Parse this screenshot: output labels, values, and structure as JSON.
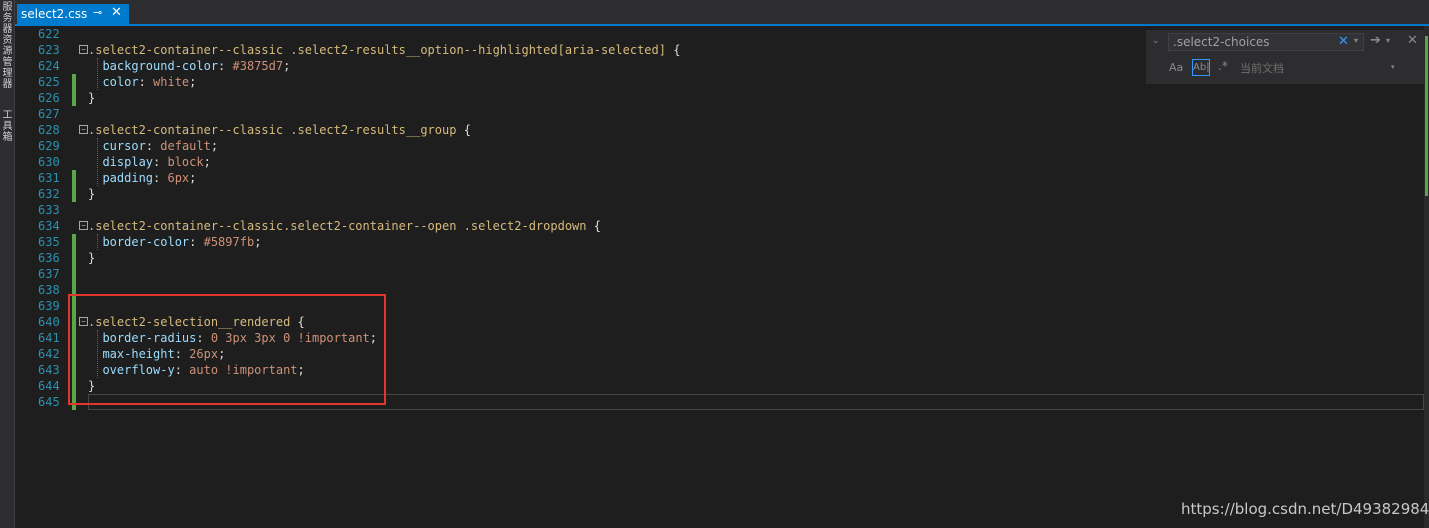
{
  "left_strip": {
    "tab1": "服务器资源管理器",
    "tab2": "工具箱"
  },
  "tab": {
    "title": "select2.css",
    "pin_icon": "pin-icon",
    "close_icon": "close-icon"
  },
  "find": {
    "value": ".select2-choices",
    "scope": "当前文档",
    "match_case": "Aa",
    "whole_word": "Ab|",
    "regex": ".*"
  },
  "colors": {
    "accent": "#007acc",
    "selector": "#d7ba7d",
    "property": "#9cdcfe",
    "value": "#ce9178",
    "line_number": "#2b91af",
    "highlight_box": "#e0362c",
    "change_bar": "#57a64a"
  },
  "lines": [
    {
      "n": "622",
      "code": ""
    },
    {
      "n": "623",
      "code": ".select2-container--classic .select2-results__option--highlighted[aria-selected] {"
    },
    {
      "n": "624",
      "code": "  background-color: #3875d7;"
    },
    {
      "n": "625",
      "code": "  color: white;"
    },
    {
      "n": "626",
      "code": "}"
    },
    {
      "n": "627",
      "code": ""
    },
    {
      "n": "628",
      "code": ".select2-container--classic .select2-results__group {"
    },
    {
      "n": "629",
      "code": "  cursor: default;"
    },
    {
      "n": "630",
      "code": "  display: block;"
    },
    {
      "n": "631",
      "code": "  padding: 6px;"
    },
    {
      "n": "632",
      "code": "}"
    },
    {
      "n": "633",
      "code": ""
    },
    {
      "n": "634",
      "code": ".select2-container--classic.select2-container--open .select2-dropdown {"
    },
    {
      "n": "635",
      "code": "  border-color: #5897fb;"
    },
    {
      "n": "636",
      "code": "}"
    },
    {
      "n": "637",
      "code": ""
    },
    {
      "n": "638",
      "code": ""
    },
    {
      "n": "639",
      "code": ""
    },
    {
      "n": "640",
      "code": ".select2-selection__rendered {"
    },
    {
      "n": "641",
      "code": "  border-radius: 0 3px 3px 0 !important;"
    },
    {
      "n": "642",
      "code": "  max-height: 26px;"
    },
    {
      "n": "643",
      "code": "  overflow-y: auto !important;"
    },
    {
      "n": "644",
      "code": "}"
    },
    {
      "n": "645",
      "code": ""
    }
  ],
  "watermark": "https://blog.csdn.net/D493829844"
}
